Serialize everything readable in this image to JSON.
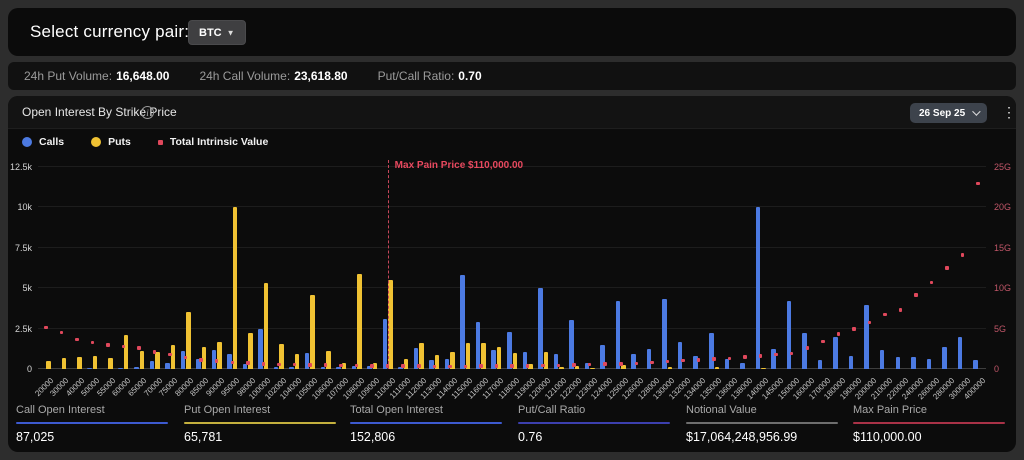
{
  "header": {
    "title": "Select currency pair:",
    "currency_button": {
      "label": "BTC"
    }
  },
  "stats_bar": {
    "items": [
      {
        "label": "24h Put Volume:",
        "value": "16,648.00"
      },
      {
        "label": "24h Call Volume:",
        "value": "23,618.80"
      },
      {
        "label": "Put/Call Ratio:",
        "value": "0.70"
      }
    ]
  },
  "chart_panel": {
    "title": "Open Interest By Strike Price",
    "info_icon": "info-icon",
    "date_selector": {
      "label": "26 Sep 25"
    },
    "menu_icon": "kebab-menu-icon"
  },
  "chart_data": {
    "type": "bar",
    "title": "Open Interest By Strike Price",
    "legend_position": "top-left",
    "grid": "horizontal-faint",
    "categories": [
      "20000",
      "30000",
      "40000",
      "50000",
      "55000",
      "60000",
      "65000",
      "70000",
      "75000",
      "80000",
      "85000",
      "90000",
      "95000",
      "98000",
      "100000",
      "102000",
      "104000",
      "105000",
      "106000",
      "107000",
      "108000",
      "109000",
      "110000",
      "111000",
      "112000",
      "113000",
      "114000",
      "115000",
      "116000",
      "117000",
      "118000",
      "119000",
      "120000",
      "121000",
      "122000",
      "123000",
      "124000",
      "125000",
      "126000",
      "128000",
      "130000",
      "132000",
      "134000",
      "135000",
      "136000",
      "138000",
      "140000",
      "145000",
      "150000",
      "160000",
      "170000",
      "180000",
      "190000",
      "200000",
      "210000",
      "220000",
      "240000",
      "260000",
      "280000",
      "300000",
      "400000"
    ],
    "series": [
      {
        "name": "Calls",
        "type": "bar",
        "axis": "left",
        "color": "#4c7ae2",
        "values": [
          0,
          0,
          0,
          60,
          0,
          80,
          100,
          500,
          350,
          1100,
          600,
          1200,
          950,
          300,
          2500,
          150,
          100,
          1000,
          120,
          100,
          200,
          200,
          3100,
          100,
          1300,
          550,
          600,
          5800,
          2900,
          1200,
          2300,
          1050,
          5000,
          900,
          3050,
          350,
          1500,
          4200,
          900,
          1250,
          4350,
          1650,
          800,
          2250,
          600,
          350,
          10000,
          1250,
          4200,
          2200,
          550,
          2000,
          800,
          3950,
          1200,
          750,
          750,
          600,
          1350,
          2000,
          550
        ]
      },
      {
        "name": "Puts",
        "type": "bar",
        "axis": "left",
        "color": "#f0c233",
        "values": [
          500,
          660,
          770,
          830,
          660,
          2100,
          1100,
          1050,
          1490,
          3500,
          1350,
          1700,
          10000,
          2200,
          5300,
          1550,
          930,
          4600,
          1140,
          350,
          5900,
          350,
          5530,
          600,
          1640,
          850,
          1050,
          1600,
          1600,
          1350,
          1000,
          300,
          1050,
          100,
          200,
          50,
          0,
          250,
          0,
          0,
          150,
          0,
          0,
          100,
          0,
          0,
          50,
          0,
          0,
          0,
          0,
          0,
          0,
          0,
          0,
          0,
          0,
          0,
          0,
          0,
          0
        ]
      },
      {
        "name": "Total Intrinsic Value",
        "type": "scatter",
        "axis": "right",
        "color": "#e0485c",
        "unit": "G",
        "values": [
          5.1,
          4.5,
          3.6,
          3.25,
          2.95,
          2.75,
          2.55,
          2.1,
          1.75,
          1.4,
          1.1,
          0.95,
          0.8,
          0.7,
          0.62,
          0.55,
          0.5,
          0.47,
          0.44,
          0.41,
          0.38,
          0.36,
          0.34,
          0.33,
          0.32,
          0.31,
          0.31,
          0.31,
          0.32,
          0.33,
          0.35,
          0.37,
          0.4,
          0.43,
          0.47,
          0.52,
          0.57,
          0.62,
          0.68,
          0.78,
          0.9,
          1.0,
          1.1,
          1.2,
          1.3,
          1.45,
          1.6,
          1.75,
          1.9,
          2.6,
          3.35,
          4.3,
          4.9,
          5.7,
          6.7,
          7.3,
          9.1,
          10.7,
          12.5,
          14.1,
          22.9
        ]
      }
    ],
    "y_left": {
      "ticks": [
        "0",
        "2.5k",
        "5k",
        "7.5k",
        "10k",
        "12.5k"
      ],
      "max": 12500,
      "min": 0
    },
    "y_right": {
      "ticks": [
        "0",
        "5G",
        "10G",
        "15G",
        "20G",
        "25G"
      ],
      "max": 25,
      "min": 0
    },
    "max_pain": {
      "index": 22,
      "strike": "110000",
      "label": "Max Pain Price $110,000.00",
      "line_color": "#c6465a"
    }
  },
  "footer_stats": [
    {
      "label": "Call Open Interest",
      "value": "87,025",
      "color": "#3d5ad0"
    },
    {
      "label": "Put Open Interest",
      "value": "65,781",
      "color": "#c4b03e"
    },
    {
      "label": "Total Open Interest",
      "value": "152,806",
      "color": "#3d5ad0"
    },
    {
      "label": "Put/Call Ratio",
      "value": "0.76",
      "color": "#3c3fae"
    },
    {
      "label": "Notional Value",
      "value": "$17,064,248,956.99",
      "color": "#6e6e6e"
    },
    {
      "label": "Max Pain Price",
      "value": "$110,000.00",
      "color": "#a93247"
    }
  ]
}
